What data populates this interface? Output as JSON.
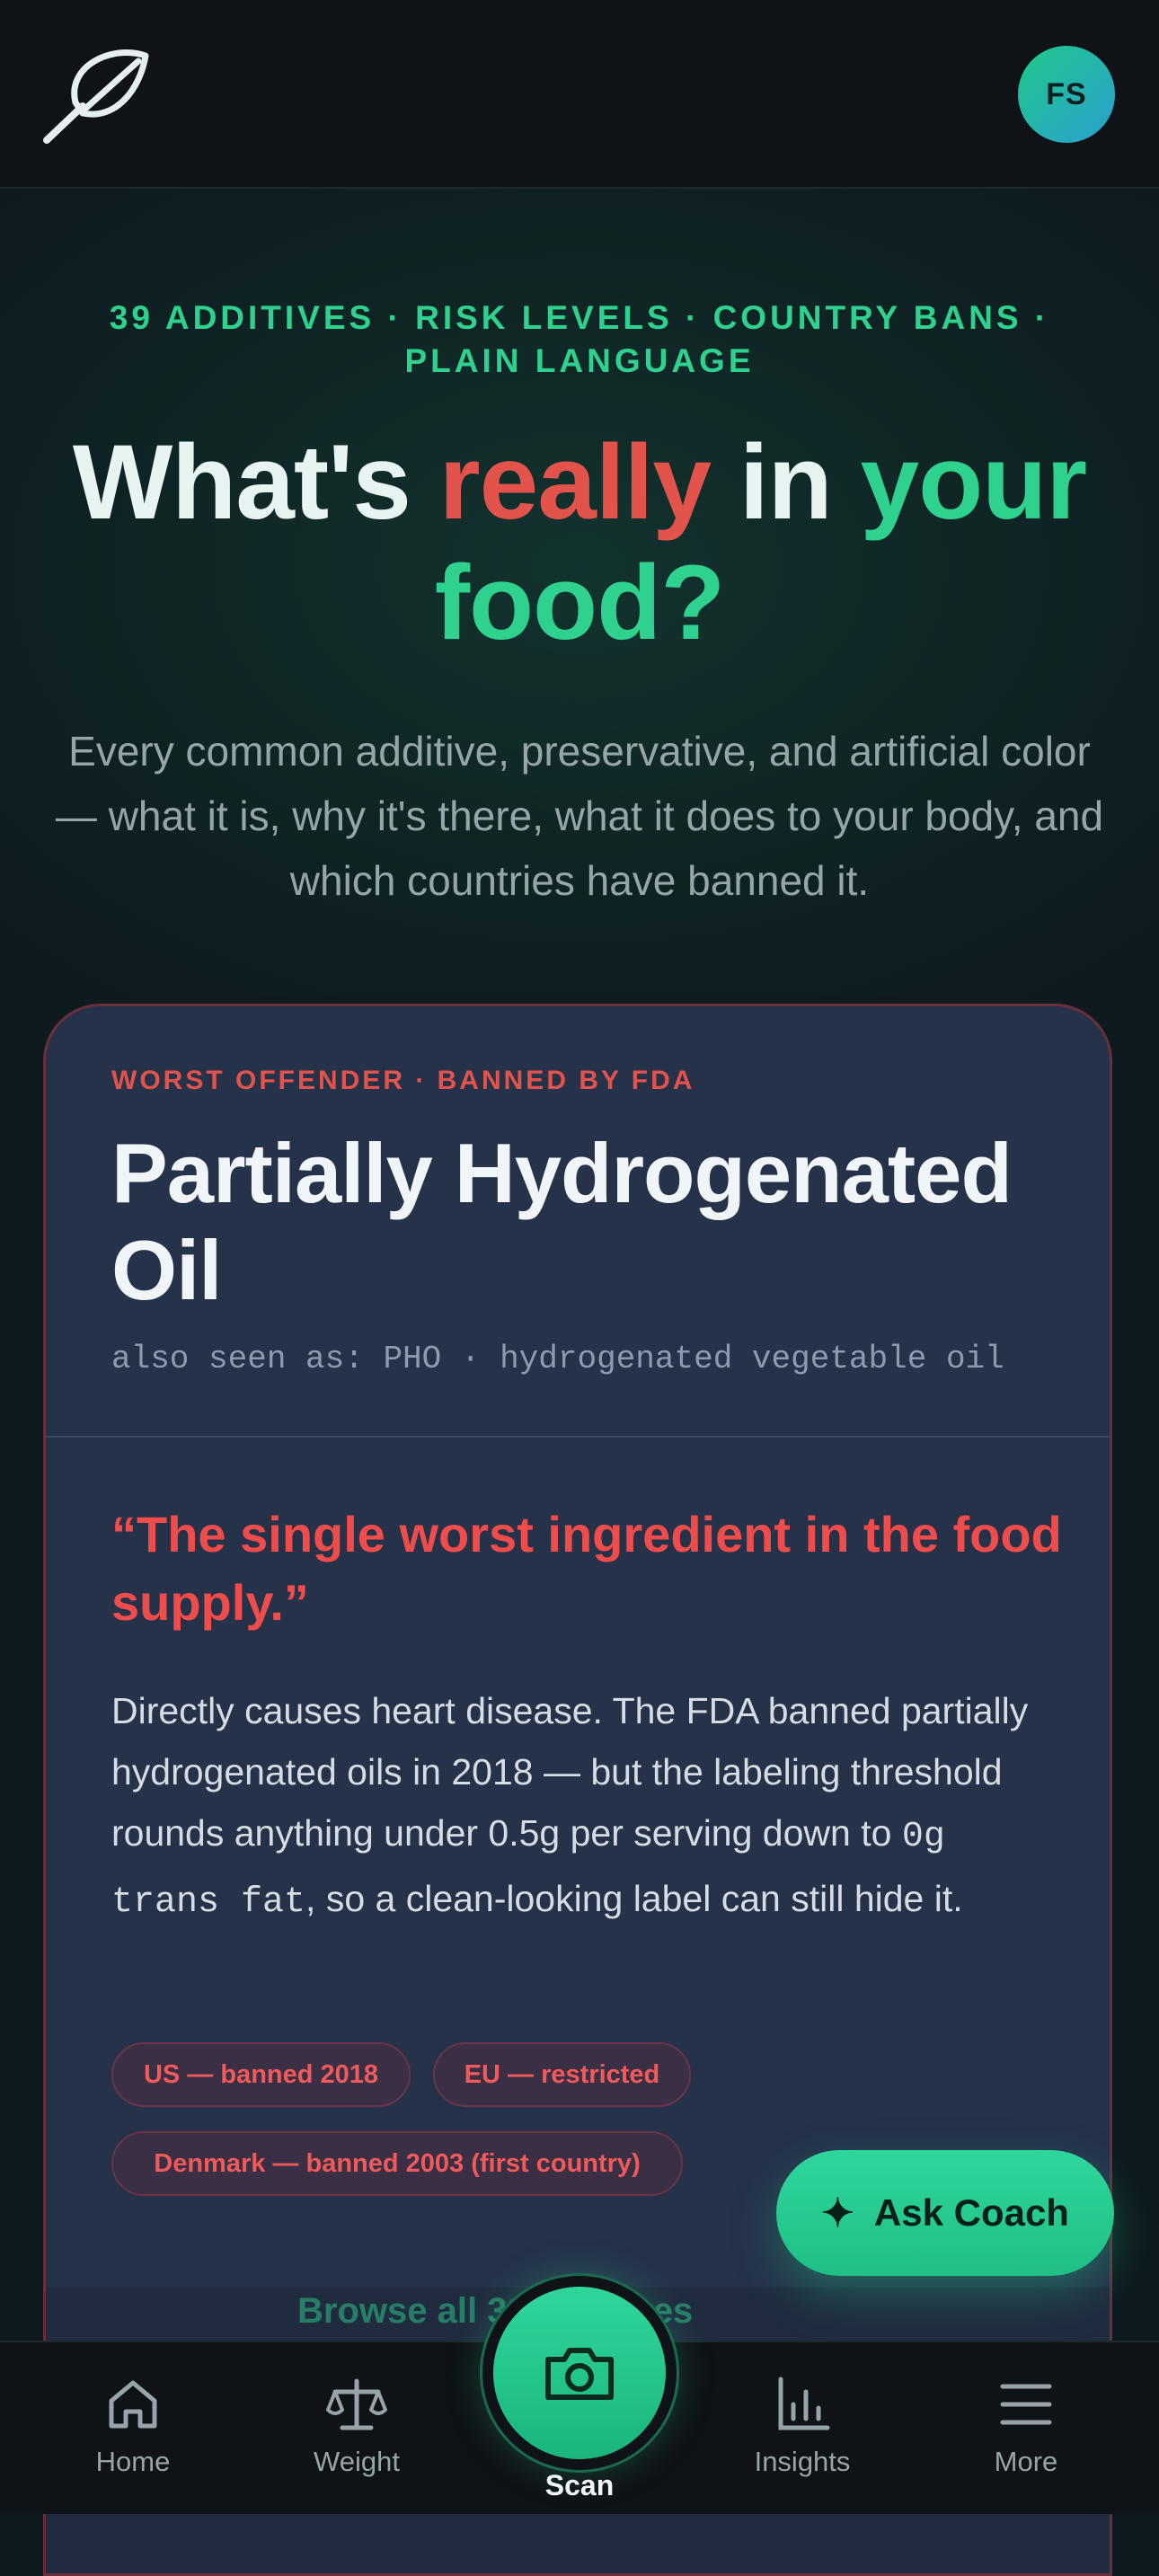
{
  "header": {
    "avatar_initials": "FS",
    "logo_icon": "leaf-icon"
  },
  "hero": {
    "eyebrow": "39 ADDITIVES · RISK LEVELS · COUNTRY BANS · PLAIN LANGUAGE",
    "headline": {
      "part1": "What's ",
      "part2": "really",
      "part3": " in ",
      "part4": "your food?"
    },
    "subtitle": "Every common additive, preservative, and artificial color — what it is, why it's there, what it does to your body, and which countries have banned it."
  },
  "featured_card": {
    "eyebrow": "WORST OFFENDER · BANNED BY FDA",
    "title": "Partially Hydrogenated Oil",
    "also_seen_as": "also seen as: PHO · hydrogenated vegetable oil",
    "quote": "“The single worst ingredient in the food supply.”",
    "description_part1": "Directly causes heart disease. The FDA banned partially hydrogenated oils in 2018 — but the labeling threshold rounds anything under 0.5g per serving down to ",
    "description_code": "0g trans fat",
    "description_part2": ", so a clean-looking label can still hide it.",
    "ban_tags": [
      "US — banned 2018",
      "EU — restricted",
      "Denmark — banned 2003 (first country)"
    ],
    "next_teaser": "Browse all 39 additives"
  },
  "coach_button": {
    "label": "Ask Coach",
    "icon": "sparkle-icon"
  },
  "colors": {
    "accent_green": "#2fd18e",
    "danger_red": "#e2534c",
    "card_bg": "#253249"
  },
  "tabbar": {
    "items": [
      {
        "label": "Home",
        "icon": "home-icon"
      },
      {
        "label": "Weight",
        "icon": "scale-icon"
      },
      {
        "label": "Scan",
        "icon": "camera-icon"
      },
      {
        "label": "Insights",
        "icon": "bar-chart-icon"
      },
      {
        "label": "More",
        "icon": "menu-icon"
      }
    ]
  }
}
